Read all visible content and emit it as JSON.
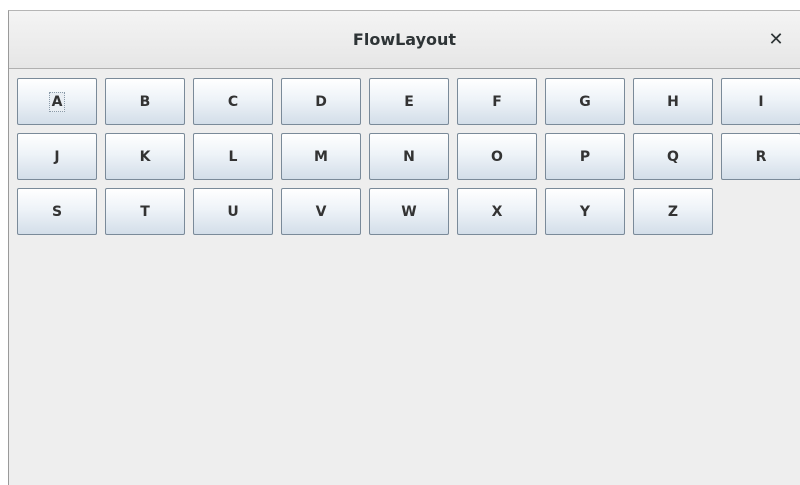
{
  "window": {
    "title": "FlowLayout",
    "close_label": "✕"
  },
  "buttons": [
    {
      "label": "A",
      "focused": true
    },
    {
      "label": "B"
    },
    {
      "label": "C"
    },
    {
      "label": "D"
    },
    {
      "label": "E"
    },
    {
      "label": "F"
    },
    {
      "label": "G"
    },
    {
      "label": "H"
    },
    {
      "label": "I"
    },
    {
      "label": "J"
    },
    {
      "label": "K"
    },
    {
      "label": "L"
    },
    {
      "label": "M"
    },
    {
      "label": "N"
    },
    {
      "label": "O"
    },
    {
      "label": "P"
    },
    {
      "label": "Q"
    },
    {
      "label": "R"
    },
    {
      "label": "S"
    },
    {
      "label": "T"
    },
    {
      "label": "U"
    },
    {
      "label": "V"
    },
    {
      "label": "W"
    },
    {
      "label": "X"
    },
    {
      "label": "Y"
    },
    {
      "label": "Z"
    }
  ]
}
